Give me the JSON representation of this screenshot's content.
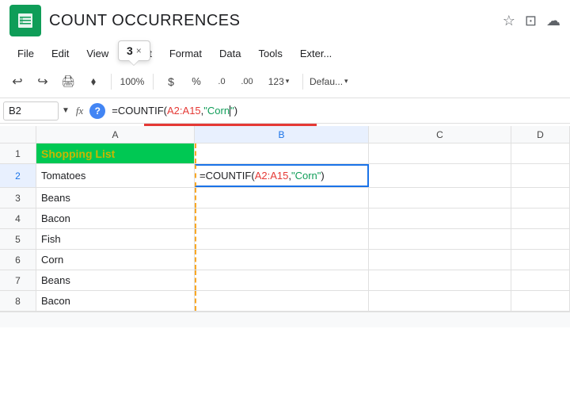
{
  "app": {
    "icon_alt": "Google Sheets",
    "title": "COUNT OCCURRENCES",
    "star_icon": "★",
    "folder_icon": "⊡",
    "cloud_icon": "☁"
  },
  "menu": {
    "items": [
      "File",
      "Edit",
      "View",
      "Insert",
      "Format",
      "Data",
      "Tools",
      "Exter..."
    ]
  },
  "toolbar": {
    "undo": "↩",
    "redo": "↪",
    "print": "🖨",
    "paint": "🎨",
    "tooltip_count": "3",
    "tooltip_x": "×",
    "currency": "$",
    "percent": "%",
    "decimal_less": ".0",
    "decimal_more": ".00",
    "number_format": "123",
    "font_name": "Defau..."
  },
  "formula_bar": {
    "cell_ref": "B2",
    "dropdown_arrow": "▼",
    "fx_label": "fx",
    "help_label": "?",
    "formula_equals": "=",
    "formula_func": "COUNTIF",
    "formula_open": "(",
    "formula_range": "A2:A15",
    "formula_comma": ", ",
    "formula_string_open": "\"",
    "formula_string_content": "Corn",
    "formula_cursor": "",
    "formula_string_close": "\"",
    "formula_close": ")"
  },
  "columns": {
    "headers": [
      "A",
      "B",
      "C",
      "D"
    ]
  },
  "rows": [
    {
      "num": "1",
      "a": "Shopping List",
      "b": "",
      "c": "",
      "d": "",
      "a_style": "shopping-list"
    },
    {
      "num": "2",
      "a": "Tomatoes",
      "b": "=COUNTIF(A2:A15, \"Corn\")",
      "c": "",
      "d": "",
      "b_style": "formula-cell"
    },
    {
      "num": "3",
      "a": "Beans",
      "b": "",
      "c": "",
      "d": ""
    },
    {
      "num": "4",
      "a": "Bacon",
      "b": "",
      "c": "",
      "d": ""
    },
    {
      "num": "5",
      "a": "Fish",
      "b": "",
      "c": "",
      "d": ""
    },
    {
      "num": "6",
      "a": "Corn",
      "b": "",
      "c": "",
      "d": ""
    },
    {
      "num": "7",
      "a": "Beans",
      "b": "",
      "c": "",
      "d": ""
    },
    {
      "num": "8",
      "a": "Bacon",
      "b": "",
      "c": "",
      "d": ""
    }
  ],
  "colors": {
    "shopping_list_bg": "#00c853",
    "shopping_list_text": "#c8b800",
    "selected_col_bg": "#e8f0fe",
    "selected_col_text": "#1a73e8",
    "formula_range_color": "#e53935",
    "formula_string_color": "#0f9d58",
    "cell_border_active": "#1a73e8",
    "dashed_border": "#f9a825"
  }
}
